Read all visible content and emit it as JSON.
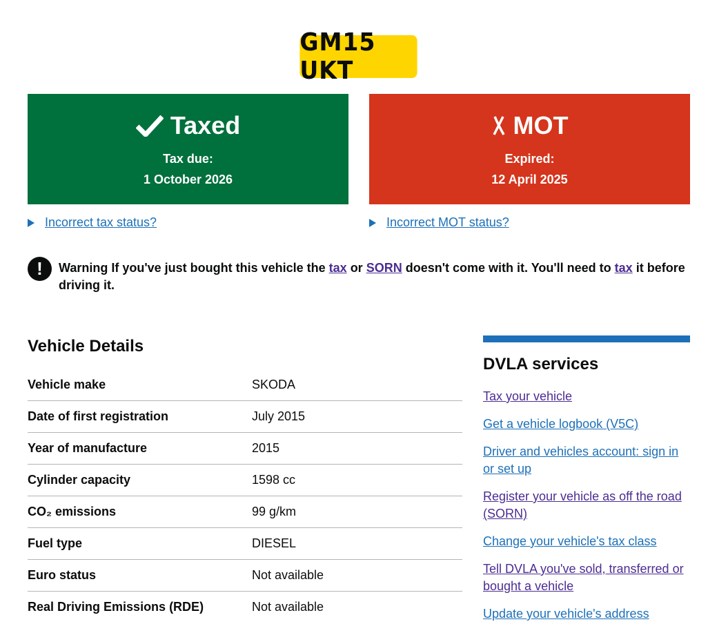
{
  "plate": "GM15 UKT",
  "tax": {
    "title": "Taxed",
    "sub_label": "Tax due:",
    "sub_value": "1 October 2026",
    "link": "Incorrect tax status?",
    "color": "#00703c",
    "icon": "check-icon"
  },
  "mot": {
    "title": "MOT",
    "sub_label": "Expired:",
    "sub_value": "12 April 2025",
    "link": "Incorrect MOT status?",
    "color": "#d4351c",
    "icon": "cross-icon"
  },
  "warning": {
    "prefix": "Warning If you've just bought this vehicle the",
    "link1": "tax",
    "mid1": "or",
    "link2": "SORN",
    "mid2": "doesn't come with it. You'll need to",
    "link3": "tax",
    "suffix": "it before driving it."
  },
  "details": {
    "heading": "Vehicle Details",
    "rows": [
      {
        "key": "Vehicle make",
        "value": "SKODA"
      },
      {
        "key": "Date of first registration",
        "value": "July 2015"
      },
      {
        "key": "Year of manufacture",
        "value": "2015"
      },
      {
        "key": "Cylinder capacity",
        "value": "1598 cc"
      },
      {
        "key": "CO₂ emissions",
        "value": "99 g/km"
      },
      {
        "key": "Fuel type",
        "value": "DIESEL"
      },
      {
        "key": "Euro status",
        "value": "Not available"
      },
      {
        "key": "Real Driving Emissions (RDE)",
        "value": "Not available"
      }
    ]
  },
  "sidebar": {
    "heading": "DVLA services",
    "links": [
      "Tax your vehicle",
      "Get a vehicle logbook (V5C)",
      "Driver and vehicles account: sign in or set up",
      "Register your vehicle as off the road (SORN)",
      "Change your vehicle's tax class",
      "Tell DVLA you've sold, transferred or bought a vehicle",
      "Update your vehicle's address"
    ]
  },
  "colors": {
    "link": "#1d70b8",
    "visited": "#4c2c92",
    "plate": "#ffd500",
    "sidebar_bar": "#1d70b8"
  }
}
